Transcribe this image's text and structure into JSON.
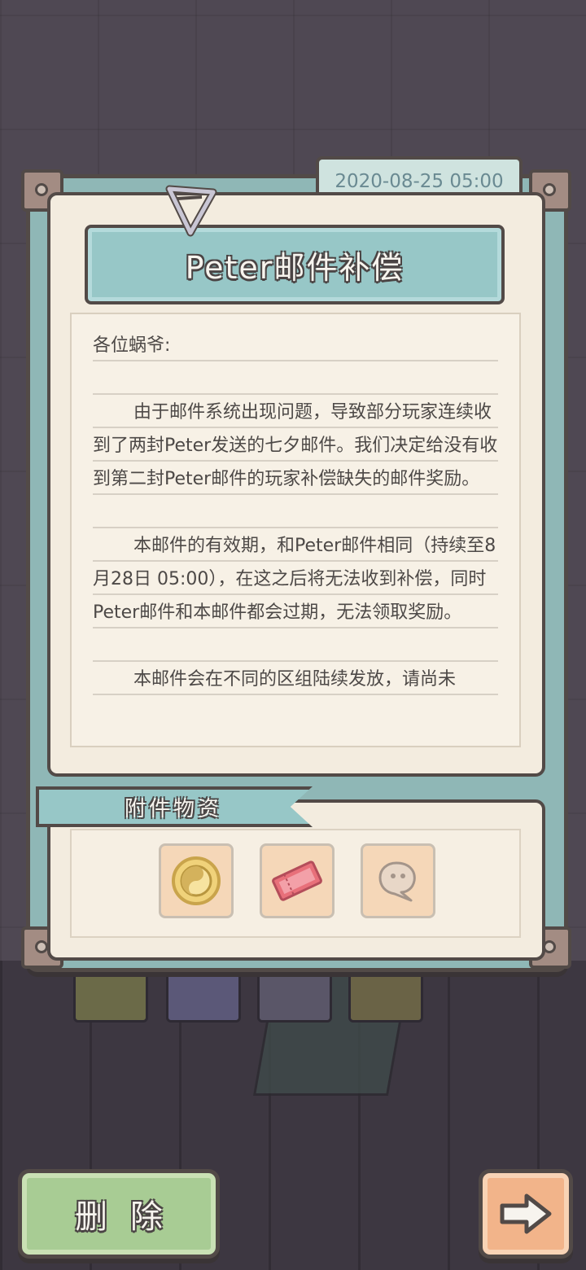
{
  "mail": {
    "date": "2020-08-25 05:00",
    "title": "Peter邮件补偿",
    "greeting": "各位蜗爷:",
    "paragraph1": "由于邮件系统出现问题，导致部分玩家连续收到了两封Peter发送的七夕邮件。我们决定给没有收到第二封Peter邮件的玩家补偿缺失的邮件奖励。",
    "paragraph2": "本邮件的有效期，和Peter邮件相同（持续至8月28日 05:00），在这之后将无法收到补偿，同时Peter邮件和本邮件都会过期，无法领取奖励。",
    "paragraph3_partial": "本邮件会在不同的区组陆续发放，请尚未"
  },
  "attachments": {
    "label": "附件物资",
    "items": [
      {
        "icon": "yin-yang-coin-icon"
      },
      {
        "icon": "ticket-icon"
      },
      {
        "icon": "speech-bubble-icon"
      }
    ]
  },
  "buttons": {
    "delete_label": "删除",
    "next_icon": "arrow-right-icon"
  },
  "colors": {
    "frame": "#8fb7b6",
    "paper": "#f3ecdf",
    "banner": "#97c7c7",
    "delete_button": "#a8cc94",
    "next_button": "#f2b48a"
  }
}
